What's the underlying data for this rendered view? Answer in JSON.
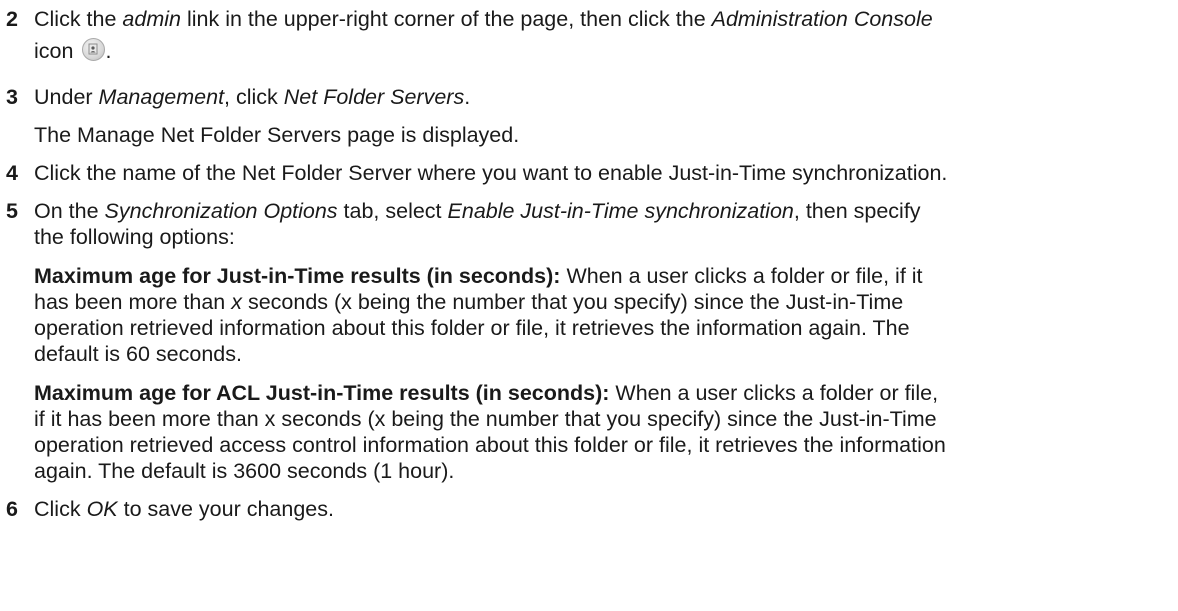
{
  "steps": [
    {
      "number": "2",
      "parts": {
        "a": "Click the ",
        "b": "admin",
        "c": " link in the upper-right corner of the page, then click the ",
        "d": "Administration Console",
        "e": "icon",
        "f": "."
      },
      "icon": "administration-console-icon"
    },
    {
      "number": "3",
      "parts": {
        "a": "Under ",
        "b": "Management",
        "c": ", click ",
        "d": "Net Folder Servers",
        "e": "."
      },
      "note": "The Manage Net Folder Servers page is displayed."
    },
    {
      "number": "4",
      "text": "Click the name of the Net Folder Server where you want to enable Just-in-Time synchronization."
    },
    {
      "number": "5",
      "parts": {
        "a": "On the ",
        "b": "Synchronization Options",
        "c": " tab, select ",
        "d": "Enable Just-in-Time synchronization",
        "e": ", then specify",
        "f": "the following options:"
      },
      "options": [
        {
          "term": "Maximum age for Just-in-Time results (in seconds):",
          "desc_a": " When a user clicks a folder or file, if it",
          "desc_b": "has been more than ",
          "desc_x": "x",
          "desc_c": " seconds (x being the number that you specify) since the Just-in-Time",
          "desc_d": "operation retrieved information about this folder or file, it retrieves the information again. The",
          "desc_e": "default is 60 seconds."
        },
        {
          "term": "Maximum age for ACL Just-in-Time results (in seconds):",
          "desc_a": " When a user clicks a folder or file,",
          "desc_b": "if it has been more than x seconds (x being the number that you specify) since the Just-in-Time",
          "desc_c": "operation retrieved access control information about this folder or file, it retrieves the information",
          "desc_d": "again. The default is 3600 seconds (1 hour)."
        }
      ]
    },
    {
      "number": "6",
      "parts": {
        "a": "Click ",
        "b": "OK",
        "c": " to save your changes."
      }
    }
  ]
}
